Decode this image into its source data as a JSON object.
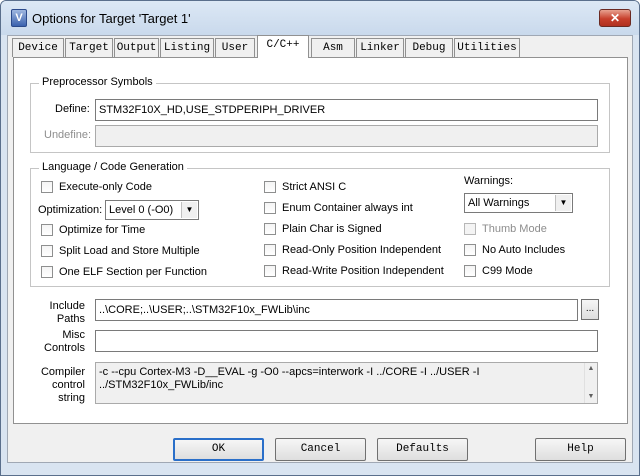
{
  "window": {
    "title": "Options for Target 'Target 1'",
    "icon_name": "uvision-app-icon",
    "close_glyph": "✕"
  },
  "tabs": [
    {
      "label": "Device"
    },
    {
      "label": "Target"
    },
    {
      "label": "Output"
    },
    {
      "label": "Listing"
    },
    {
      "label": "User"
    },
    {
      "label": "C/C++",
      "active": true
    },
    {
      "label": "Asm"
    },
    {
      "label": "Linker"
    },
    {
      "label": "Debug"
    },
    {
      "label": "Utilities"
    }
  ],
  "preprocessor": {
    "title": "Preprocessor Symbols",
    "define_label": "Define:",
    "define_value": "STM32F10X_HD,USE_STDPERIPH_DRIVER",
    "undefine_label": "Undefine:",
    "undefine_value": ""
  },
  "language": {
    "title": "Language / Code Generation",
    "execute_only": {
      "label": "Execute-only Code",
      "checked": false
    },
    "optimization_label": "Optimization:",
    "optimization_value": "Level 0 (-O0)",
    "optimize_time": {
      "label": "Optimize for Time",
      "checked": false
    },
    "split_load": {
      "label": "Split Load and Store Multiple",
      "checked": false
    },
    "one_elf": {
      "label": "One ELF Section per Function",
      "checked": false
    },
    "strict_ansi": {
      "label": "Strict ANSI C",
      "checked": false
    },
    "enum_container": {
      "label": "Enum Container always int",
      "checked": false
    },
    "plain_char": {
      "label": "Plain Char is Signed",
      "checked": false
    },
    "ropi": {
      "label": "Read-Only Position Independent",
      "checked": false
    },
    "rwpi": {
      "label": "Read-Write Position Independent",
      "checked": false
    },
    "warnings_label": "Warnings:",
    "warnings_value": "All Warnings",
    "thumb_mode": {
      "label": "Thumb Mode",
      "checked": false,
      "disabled": true
    },
    "no_auto_includes": {
      "label": "No Auto Includes",
      "checked": false
    },
    "c99_mode": {
      "label": "C99 Mode",
      "checked": false
    }
  },
  "include_paths": {
    "label_line1": "Include",
    "label_line2": "Paths",
    "value": "..\\CORE;..\\USER;..\\STM32F10x_FWLib\\inc",
    "browse_label": "..."
  },
  "misc_controls": {
    "label_line1": "Misc",
    "label_line2": "Controls",
    "value": ""
  },
  "compiler_string": {
    "label_line1": "Compiler",
    "label_line2": "control",
    "label_line3": "string",
    "value": "-c --cpu Cortex-M3 -D__EVAL -g -O0 --apcs=interwork -I ../CORE -I ../USER -I\n../STM32F10x_FWLib/inc"
  },
  "buttons": {
    "ok": "OK",
    "cancel": "Cancel",
    "defaults": "Defaults",
    "help": "Help"
  }
}
